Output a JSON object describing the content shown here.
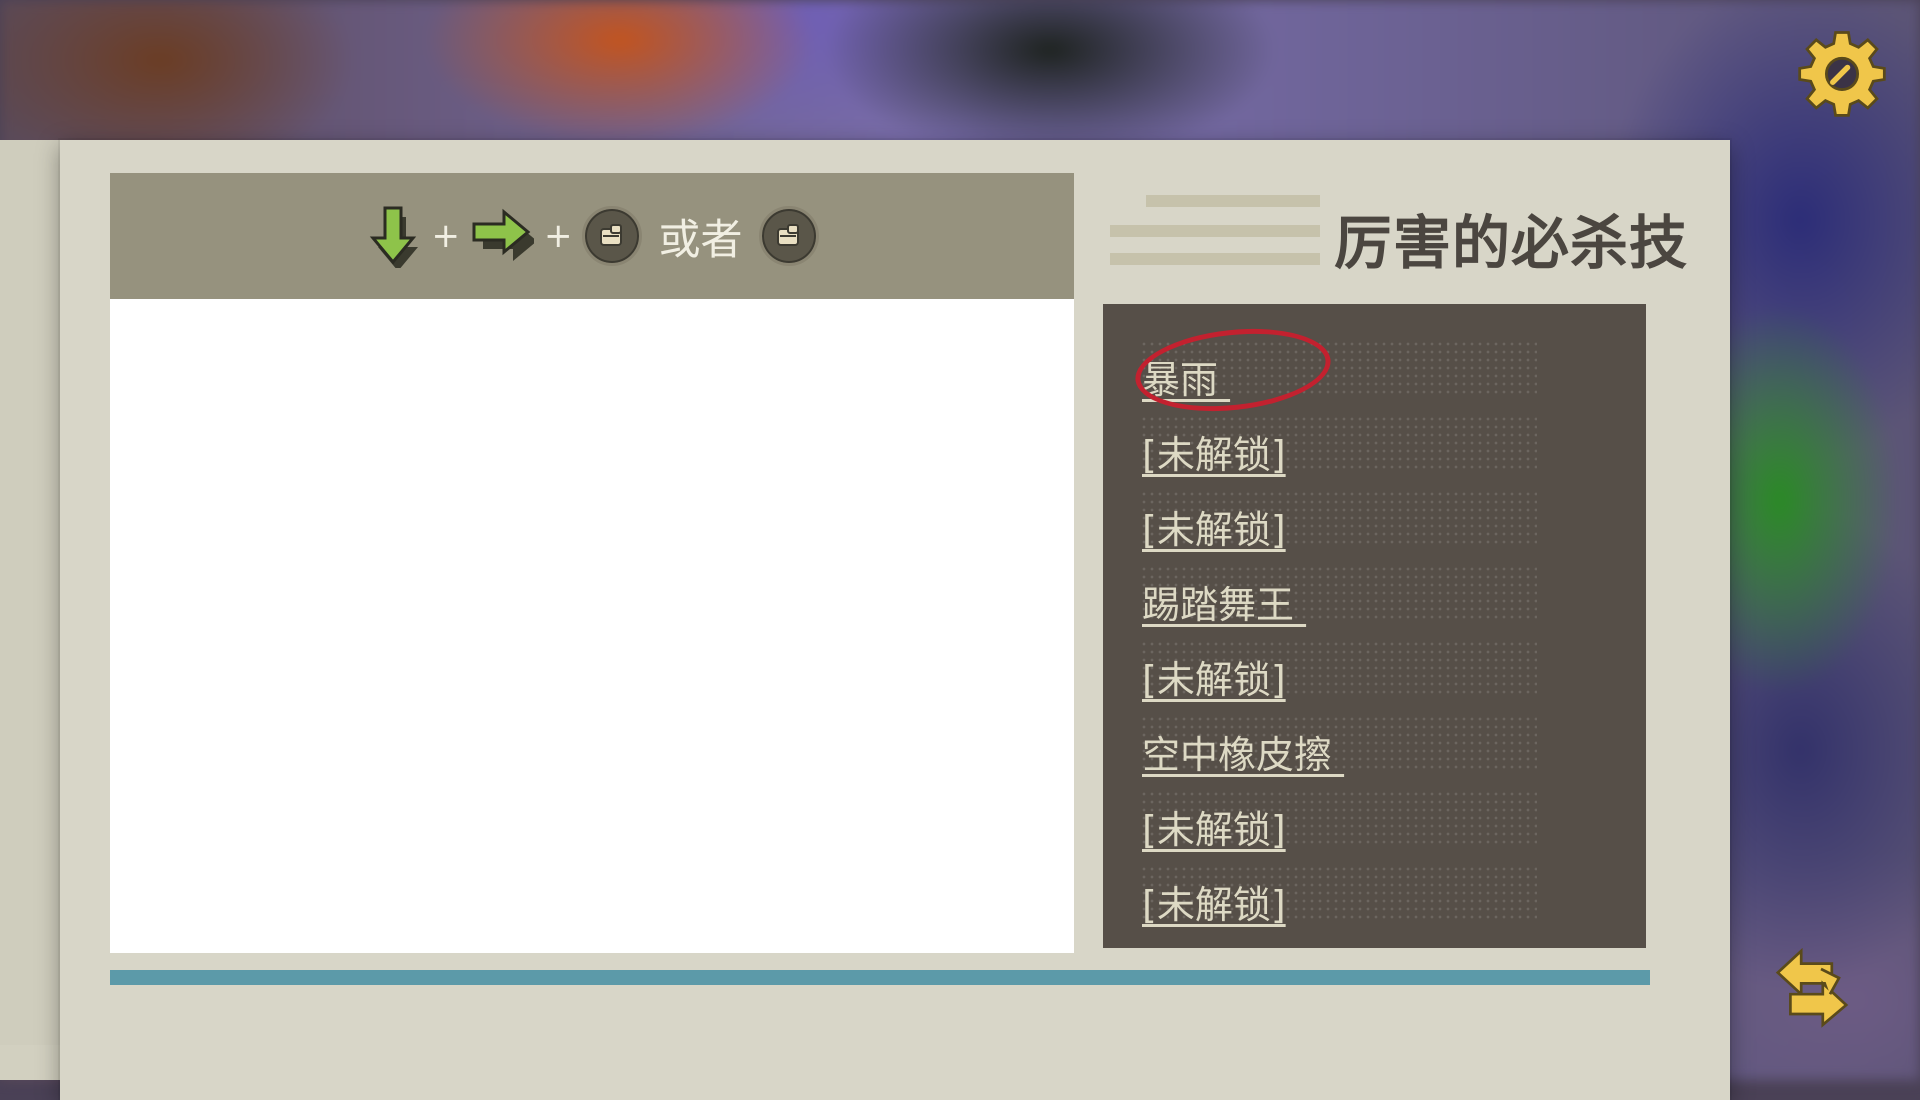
{
  "header": {
    "title": "厉害的必杀技",
    "combo": {
      "inputs": [
        "arrow-down-icon",
        "arrow-right-icon",
        "punch-button-icon"
      ],
      "plus": "+",
      "or_label": "或者",
      "alt_input": "punch-button-icon"
    }
  },
  "moves": [
    {
      "label": "暴雨 ",
      "selected": true
    },
    {
      "label": "[未解锁]",
      "selected": false
    },
    {
      "label": "[未解锁]",
      "selected": false
    },
    {
      "label": "踢踏舞王 ",
      "selected": false
    },
    {
      "label": "[未解锁]",
      "selected": false
    },
    {
      "label": "空中橡皮擦 ",
      "selected": false
    },
    {
      "label": "[未解锁]",
      "selected": false
    },
    {
      "label": "[未解锁]",
      "selected": false
    }
  ],
  "colors": {
    "paper": "#d8d6c8",
    "combo_bar": "#96927e",
    "moves_panel": "#564f48",
    "selection_circle": "#c3212f",
    "divider": "#5c9aa9",
    "icon_gold": "#f0c64a"
  },
  "icons": {
    "settings": "gear-icon",
    "back": "back-arrow-icon"
  }
}
